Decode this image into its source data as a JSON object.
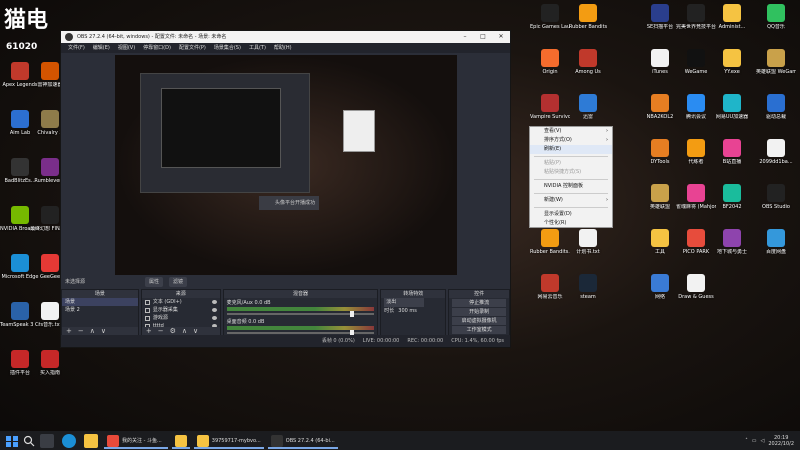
{
  "overlay": {
    "logo": "猫电",
    "viewer_count": "61020"
  },
  "desktop_left": [
    {
      "label": "Apex Legends",
      "color": "#c0392b"
    },
    {
      "label": "雷神加速器",
      "color": "#d35400"
    },
    {
      "label": "Aim Lab",
      "color": "#2c6fd1"
    },
    {
      "label": "Chivalry 2",
      "color": "#8e7b4a"
    },
    {
      "label": "BadBlitzEs...",
      "color": "#333333"
    },
    {
      "label": "Rumblever...",
      "color": "#7a2e8a"
    },
    {
      "label": "NVIDIA Broadcast",
      "color": "#76b900"
    },
    {
      "label": "最终幻想 FINAL BETA",
      "color": "#222222"
    },
    {
      "label": "Microsoft Edge",
      "color": "#1b8fd6"
    },
    {
      "label": "GeeGee",
      "color": "#e53935"
    },
    {
      "label": "TeamSpeak 3 Client",
      "color": "#2a62a8"
    },
    {
      "label": "rs音乐.txt",
      "color": "#f2f2f2"
    },
    {
      "label": "插件平台",
      "color": "#c62828"
    },
    {
      "label": "买入指南",
      "color": "#c62828"
    }
  ],
  "desktop_right": [
    {
      "label": "Epic Games Launcher",
      "color": "#222222"
    },
    {
      "label": "Rubber Bandits",
      "color": "#f39c12"
    },
    {
      "label": "SE扫描平台",
      "color": "#2a3e8c"
    },
    {
      "label": "完美世界竞技平台",
      "color": "#222222"
    },
    {
      "label": "Administ...",
      "color": "#f5c342"
    },
    {
      "label": "QQ音乐",
      "color": "#30c15f"
    },
    {
      "label": "Origin",
      "color": "#f56c2d"
    },
    {
      "label": "Among Us",
      "color": "#c0392b"
    },
    {
      "label": "iTunes",
      "color": "#f2f2f2"
    },
    {
      "label": "WeGame",
      "color": "#111111"
    },
    {
      "label": "YY.exe",
      "color": "#f5c342"
    },
    {
      "label": "英雄联盟 WeGame版",
      "color": "#c9a14a"
    },
    {
      "label": "Vampire Survivors",
      "color": "#b33030"
    },
    {
      "label": "迅雷",
      "color": "#2e7bd6"
    },
    {
      "label": "NBA2KOL2",
      "color": "#e67e22"
    },
    {
      "label": "腾讯会议",
      "color": "#2a8cf2"
    },
    {
      "label": "网易UU加速器",
      "color": "#1fb5c9"
    },
    {
      "label": "驱动总裁",
      "color": "#2a6fd1"
    },
    {
      "label": "WPS Office",
      "color": "#c0392b"
    },
    {
      "label": "大富翁 10(Richm...)",
      "color": "#d35400"
    },
    {
      "label": "DYTools",
      "color": "#e67e22"
    },
    {
      "label": "代练者",
      "color": "#f39c12"
    },
    {
      "label": "B站直播",
      "color": "#e84393"
    },
    {
      "label": "2099dd1ba...",
      "color": "#f2f2f2"
    },
    {
      "label": "Dread Hunger",
      "color": "#5b3a29"
    },
    {
      "label": "mGBA",
      "color": "#7a52c7"
    },
    {
      "label": "英雄联盟",
      "color": "#c9a14a"
    },
    {
      "label": "雀魂麻将 (Mahjong...)",
      "color": "#e84393"
    },
    {
      "label": "BF2042",
      "color": "#1abc9c"
    },
    {
      "label": "OBS Studio",
      "color": "#222222"
    },
    {
      "label": "Rubber Bandits...",
      "color": "#f39c12"
    },
    {
      "label": "计划书.txt",
      "color": "#f2f2f2"
    },
    {
      "label": "工具",
      "color": "#f5c342"
    },
    {
      "label": "PICO PARK",
      "color": "#e74c3c"
    },
    {
      "label": "地下城与勇士",
      "color": "#8e44ad"
    },
    {
      "label": "百度网盘",
      "color": "#3498db"
    },
    {
      "label": "网易云音乐",
      "color": "#c0392b"
    },
    {
      "label": "steam",
      "color": "#1b2838"
    },
    {
      "label": "网络",
      "color": "#3a7bd5"
    },
    {
      "label": "Draw & Guess",
      "color": "#f2f2f2"
    }
  ],
  "obs": {
    "title": "OBS 27.2.4 (64-bit, windows) - 配置文件: 未命名 - 场景: 未命名",
    "menu": [
      "文件(F)",
      "编辑(E)",
      "视图(V)",
      "停靠窗口(D)",
      "配置文件(P)",
      "场景集合(S)",
      "工具(T)",
      "帮助(H)"
    ],
    "preview_button": "头像平台开播成功",
    "no_source": "未选择源",
    "preview_buttons": [
      "属性",
      "滤镜"
    ],
    "docks": {
      "scenes": {
        "title": "场景",
        "items": [
          "场景",
          "场景 2"
        ]
      },
      "sources": {
        "title": "来源",
        "items": [
          "文本 (GDI+)",
          "显示器采集",
          "游戏源",
          "ttttd",
          "媒体"
        ]
      },
      "mixer": {
        "title": "混音器",
        "channels": [
          {
            "name": "麦克风/Aux",
            "level": "0.0 dB"
          },
          {
            "name": "桌面音频",
            "level": "0.0 dB"
          }
        ]
      },
      "transitions": {
        "title": "转场特效",
        "type": "淡出",
        "duration_label": "时长",
        "duration": "300 ms"
      },
      "controls": {
        "title": "控件",
        "buttons": [
          "停止推流",
          "开始录制",
          "启动虚拟摄像机",
          "工作室模式",
          "设置",
          "退出"
        ]
      }
    },
    "status": [
      "丢帧 0 (0.0%)",
      "LIVE: 00:00:00",
      "REC: 00:00:00",
      "CPU: 1.4%, 60.00 fps"
    ]
  },
  "context_menu": {
    "items": [
      {
        "label": "查看(V)",
        "arrow": true,
        "disabled": false
      },
      {
        "label": "排序方式(O)",
        "arrow": true,
        "disabled": false
      },
      {
        "label": "刷新(E)",
        "arrow": false,
        "disabled": false,
        "highlight": true
      },
      {
        "sep": true
      },
      {
        "label": "粘贴(P)",
        "arrow": false,
        "disabled": true
      },
      {
        "label": "粘贴快捷方式(S)",
        "arrow": false,
        "disabled": true
      },
      {
        "sep": true
      },
      {
        "label": "NVIDIA 控制面板",
        "arrow": false,
        "disabled": false
      },
      {
        "sep": true
      },
      {
        "label": "新建(W)",
        "arrow": true,
        "disabled": false
      },
      {
        "sep": true
      },
      {
        "label": "显示设置(D)",
        "arrow": false,
        "disabled": false
      },
      {
        "label": "个性化(R)",
        "arrow": false,
        "disabled": false
      }
    ]
  },
  "taskbar": {
    "tasks": [
      {
        "label": "我的关注 - 斗鱼...",
        "color": "#e84a3a"
      },
      {
        "label": "",
        "color": "#f5c342"
      },
      {
        "label": "39759717-mybvo...",
        "color": "#f5c342"
      },
      {
        "label": "OBS 27.2.4 (64-bi...",
        "color": "#333333"
      }
    ],
    "time": "20:19",
    "date": "2022/10/2"
  }
}
